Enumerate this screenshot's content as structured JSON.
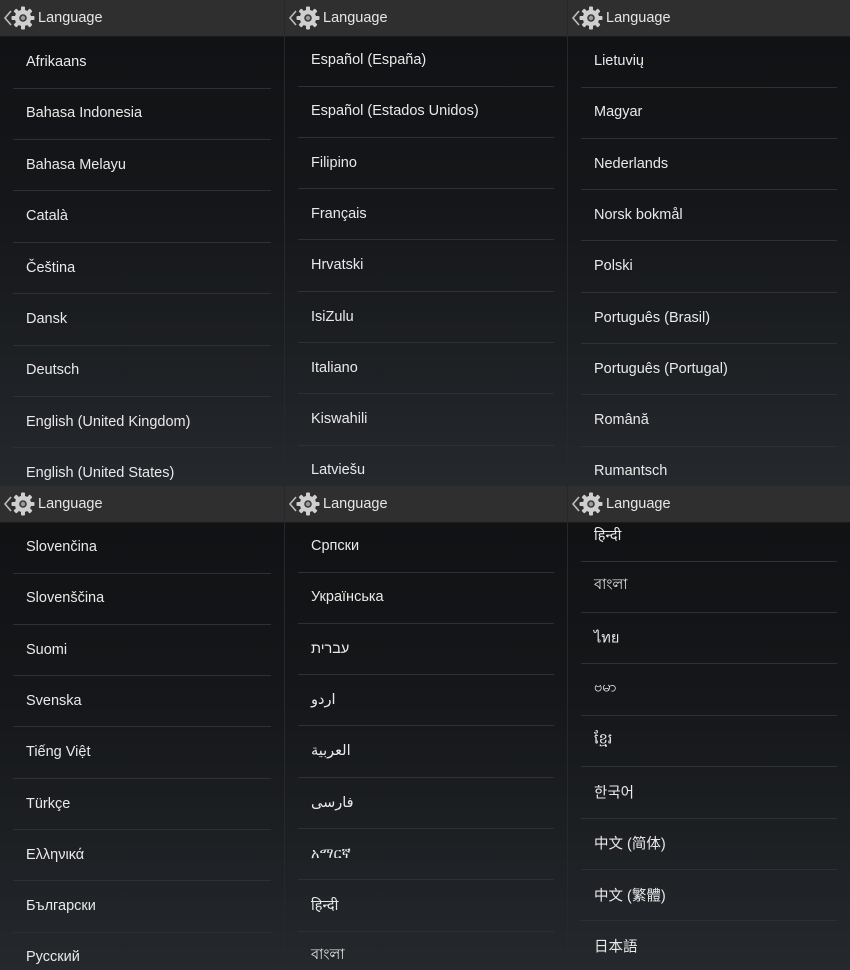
{
  "screens": [
    {
      "title": "Language",
      "items": [
        "Afrikaans",
        "Bahasa Indonesia",
        "Bahasa Melayu",
        "Català",
        "Čeština",
        "Dansk",
        "Deutsch",
        "English (United Kingdom)",
        "English (United States)"
      ]
    },
    {
      "title": "Language",
      "items": [
        "Español (España)",
        "Español (Estados Unidos)",
        "Filipino",
        "Français",
        "Hrvatski",
        "IsiZulu",
        "Italiano",
        "Kiswahili",
        "Latviešu"
      ]
    },
    {
      "title": "Language",
      "items": [
        "Lietuvių",
        "Magyar",
        "Nederlands",
        "Norsk bokmål",
        "Polski",
        "Português (Brasil)",
        "Português (Portugal)",
        "Română",
        "Rumantsch"
      ]
    },
    {
      "title": "Language",
      "items": [
        "Slovenčina",
        "Slovenščina",
        "Suomi",
        "Svenska",
        "Tiếng Việt",
        "Türkçe",
        "Ελληνικά",
        "Български",
        "Русский"
      ]
    },
    {
      "title": "Language",
      "items": [
        "Српски",
        "Українська",
        "עברית",
        "اردو",
        "العربية",
        "فارسی",
        "አማርኛ",
        "हिन्दी",
        "বাংলা"
      ]
    },
    {
      "title": "Language",
      "items": [
        "हिन्दी",
        "বাংলা",
        "ไทย",
        "ဗမာ",
        "ខ្មែរ",
        "한국어",
        "中文 (简体)",
        "中文 (繁體)",
        "日本語"
      ]
    }
  ],
  "icons": {
    "up": "chevron-left-icon",
    "app": "settings-gear-icon"
  },
  "colors": {
    "action_bar": "#2f2f2f",
    "text": "#e9e9e9",
    "divider": "#2e3034"
  }
}
